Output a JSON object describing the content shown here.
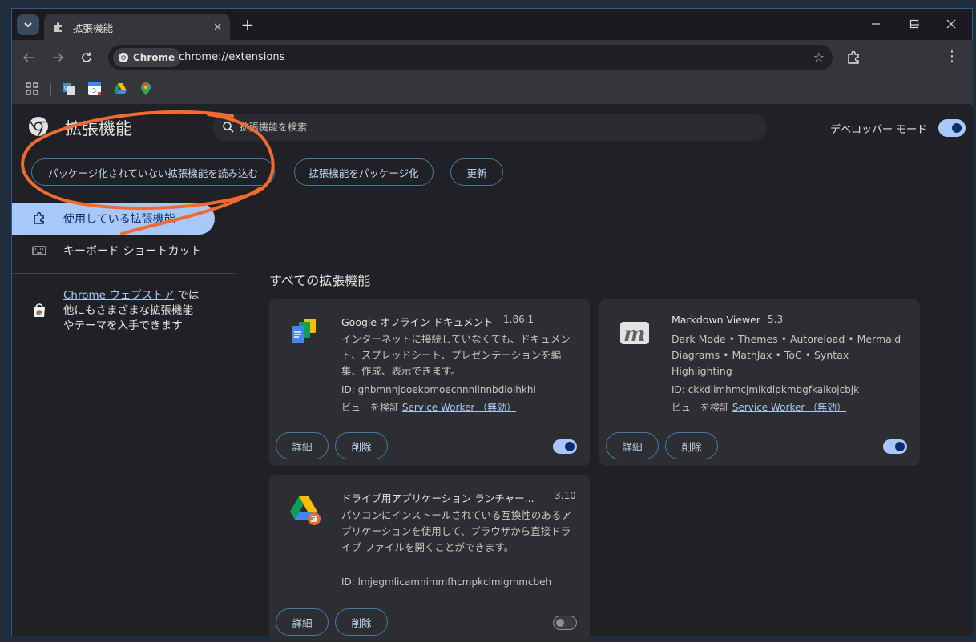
{
  "tab": {
    "title": "拡張機能",
    "icon": "puzzle-icon"
  },
  "omnibox": {
    "chip_label": "Chrome",
    "url": "chrome://extensions"
  },
  "page": {
    "title": "拡張機能",
    "search_placeholder": "拡張機能を検索",
    "dev_mode_label": "デベロッパー モード",
    "dev_mode_on": true,
    "buttons": {
      "load_unpacked": "パッケージ化されていない拡張機能を読み込む",
      "pack": "拡張機能をパッケージ化",
      "update": "更新"
    }
  },
  "sidebar": {
    "items": [
      {
        "label": "使用している拡張機能",
        "icon": "puzzle-icon",
        "active": true
      },
      {
        "label": "キーボード ショートカット",
        "icon": "keyboard-icon",
        "active": false
      }
    ],
    "webstore": {
      "link": "Chrome ウェブストア",
      "text_1": " では",
      "text_2": "他にもさまざまな拡張機能",
      "text_3": "やテーマを入手できます"
    }
  },
  "section_title": "すべての拡張機能",
  "extensions": [
    {
      "name": "Google オフライン ドキュメント",
      "version": "1.86.1",
      "description": "インターネットに接続していなくても、ドキュメント、スプレッドシート、プレゼンテーションを編集、作成、表示できます。",
      "id": "ID: ghbmnnjooekpmoecnnnilnnbdlolhkhi",
      "inspect_label": "ビューを検証",
      "inspect_link": "Service Worker （無効）",
      "enabled": true
    },
    {
      "name": "Markdown Viewer",
      "version": "5.3",
      "description": "Dark Mode • Themes • Autoreload • Mermaid Diagrams • MathJax • ToC • Syntax Highlighting",
      "id": "ID: ckkdlimhmcjmikdlpkmbgfkaikojcbjk",
      "inspect_label": "ビューを検証",
      "inspect_link": "Service Worker （無効）",
      "enabled": true
    },
    {
      "name": "ドライブ用アプリケーション ランチャー...",
      "version": "3.10",
      "description": "パソコンにインストールされている互換性のあるアプリケーションを使用して、ブラウザから直接ドライブ ファイルを開くことができます。",
      "id": "ID: lmjegmlicamnimmfhcmpkclmigmmcbeh",
      "enabled": false
    }
  ],
  "card_buttons": {
    "details": "詳細",
    "remove": "削除"
  },
  "colors": {
    "accent": "#a8c7fa",
    "annotation": "#f26a2e",
    "page_bg": "#202124"
  }
}
